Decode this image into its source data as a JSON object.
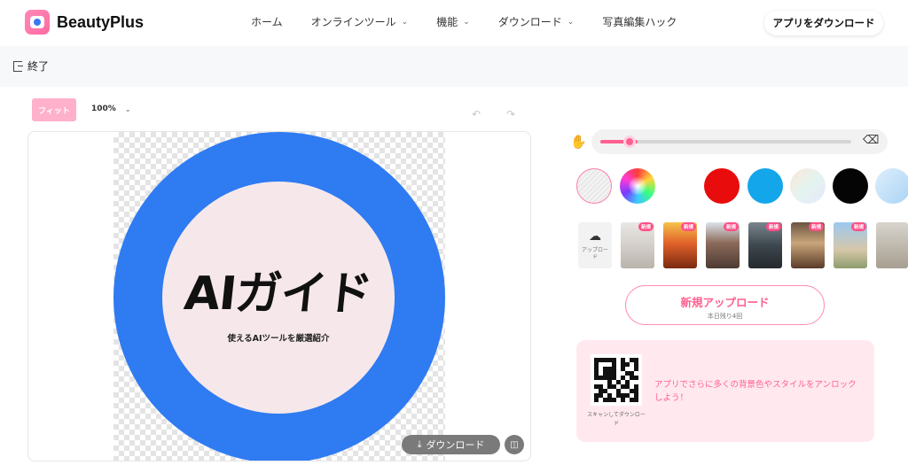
{
  "header": {
    "brand": "BeautyPlus",
    "nav": [
      {
        "label": "ホーム",
        "dropdown": false
      },
      {
        "label": "オンラインツール",
        "dropdown": true
      },
      {
        "label": "機能",
        "dropdown": true
      },
      {
        "label": "ダウンロード",
        "dropdown": true
      },
      {
        "label": "写真編集ハック",
        "dropdown": false
      }
    ],
    "app_download_label": "アプリをダウンロード"
  },
  "subbar": {
    "exit_label": "終了",
    "exit_icon": "exit-icon"
  },
  "toolbar": {
    "fit_label": "フィット",
    "zoom_value": "100%",
    "undo_icon": "undo-icon",
    "redo_icon": "redo-icon"
  },
  "canvas": {
    "image_title": "AIガイド",
    "image_subtitle": "使えるAIツールを厳選紹介",
    "download_label": "ダウンロード",
    "download_icon": "download-icon",
    "compare_icon": "compare-icon",
    "ring_color": "#2f7bf2"
  },
  "panel": {
    "brush_icon": "brush-icon",
    "eraser_icon": "eraser-icon",
    "brush_size_fraction": 0.15,
    "colors": [
      {
        "name": "none",
        "value": "transparent"
      },
      {
        "name": "rainbow",
        "value": "custom"
      },
      {
        "name": "red",
        "value": "#e80c0c"
      },
      {
        "name": "blue",
        "value": "#14a6ea"
      },
      {
        "name": "pastel-gradient",
        "value": "gradient"
      },
      {
        "name": "black",
        "value": "#050505"
      },
      {
        "name": "light-blue",
        "value": "#a8d4f5"
      }
    ],
    "upload_tile_label": "アップロード",
    "upload_icon": "upload-cloud-icon",
    "backgrounds": [
      {
        "badge": "新規"
      },
      {
        "badge": "新規"
      },
      {
        "badge": "新規"
      },
      {
        "badge": "新規"
      },
      {
        "badge": "新規"
      },
      {
        "badge": "新規"
      },
      {
        "badge": ""
      }
    ],
    "new_upload_label": "新規アップロード",
    "remaining_label": "本日残り4回",
    "promo": {
      "scan_caption": "スキャンしてダウンロード",
      "text": "アプリでさらに多くの背景色やスタイルをアンロックしよう！"
    },
    "accent_color": "#ff5f8f"
  }
}
